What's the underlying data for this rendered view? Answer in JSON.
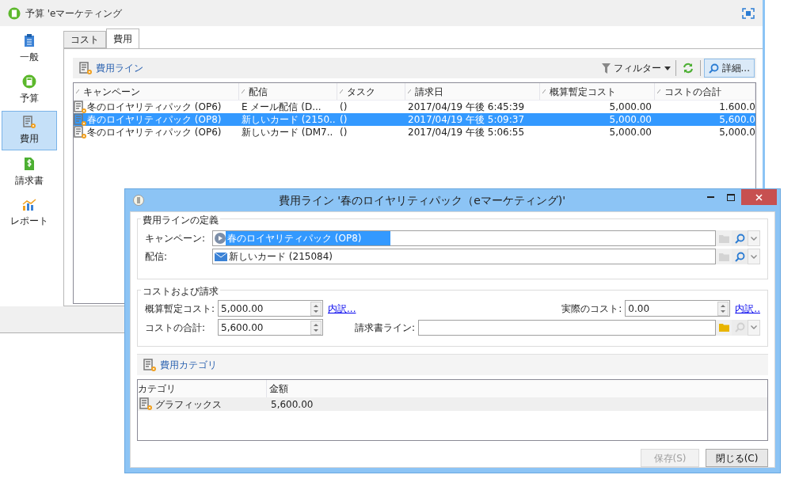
{
  "window": {
    "title": "予算 'eマーケティング"
  },
  "sidebar": {
    "items": [
      {
        "label": "一般",
        "kind": "general",
        "selected": false
      },
      {
        "label": "予算",
        "kind": "budget",
        "selected": false
      },
      {
        "label": "費用",
        "kind": "expense",
        "selected": true
      },
      {
        "label": "請求書",
        "kind": "invoice",
        "selected": false
      },
      {
        "label": "レポート",
        "kind": "report",
        "selected": false
      }
    ]
  },
  "tabs": [
    {
      "label": "コスト",
      "selected": false
    },
    {
      "label": "費用",
      "selected": true
    }
  ],
  "toolbar": {
    "title": "費用ライン",
    "filter": "フィルター",
    "details": "詳細..."
  },
  "table": {
    "columns": [
      "キャンペーン",
      "配信",
      "タスク",
      "請求日",
      "概算暫定コスト",
      "コストの合計"
    ],
    "rows": [
      {
        "cells": [
          "冬のロイヤリティパック (OP6)",
          "E メール配信 (D...",
          "()",
          "2017/04/19 午後 6:45:39",
          "5,000.00",
          "1.600.0"
        ],
        "selected": false
      },
      {
        "cells": [
          "春のロイヤリティパック (OP8)",
          "新しいカード (2150..",
          "()",
          "2017/04/19 午後 5:09:37",
          "5,000.00",
          "5,600.0"
        ],
        "selected": true
      },
      {
        "cells": [
          "冬のロイヤリティパック (OP6)",
          "新しいカード (DM7..",
          "()",
          "2017/04/19 午後 5:06:55",
          "5,000.00",
          "5,000.0"
        ],
        "selected": false
      }
    ]
  },
  "dialog": {
    "title": "費用ライン '春のロイヤリティパック（eマーケティング)'",
    "definition": {
      "legend": "費用ラインの定義",
      "campaign_label": "キャンペーン:",
      "campaign": "春のロイヤリティパック (OP8)",
      "delivery_label": "配信:",
      "delivery": "新しいカード (215084)"
    },
    "costs": {
      "legend": "コストおよび請求",
      "estimated_label": "概算暫定コスト:",
      "estimated": "5,000.00",
      "estimated_link": "内訳...",
      "actual_label": "実際のコスト:",
      "actual": "0.00",
      "actual_link": "内訳..",
      "total_label": "コストの合計:",
      "total": "5,600.00",
      "invoice_label": "請求書ライン:"
    },
    "categories": {
      "title": "費用カテゴリ",
      "columns": [
        "カテゴリ",
        "金額"
      ],
      "rows": [
        {
          "cells": [
            "グラフィックス",
            "5,600.00"
          ],
          "selected": true
        }
      ]
    },
    "buttons": [
      {
        "label": "保存(S)",
        "disabled": true
      },
      {
        "label": "閉じる(C)",
        "disabled": false
      }
    ]
  }
}
